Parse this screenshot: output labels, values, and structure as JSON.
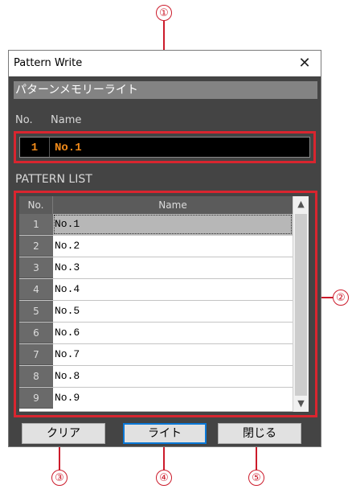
{
  "window": {
    "title": "Pattern Write",
    "heading": "パターンメモリーライト"
  },
  "current_pattern": {
    "no_label": "No.",
    "name_label": "Name",
    "no": "1",
    "name": "No.1"
  },
  "pattern_list": {
    "label": "PATTERN LIST",
    "columns": [
      "No.",
      "Name"
    ],
    "rows": [
      {
        "no": "1",
        "name": "No.1",
        "selected": true
      },
      {
        "no": "2",
        "name": "No.2"
      },
      {
        "no": "3",
        "name": "No.3"
      },
      {
        "no": "4",
        "name": "No.4"
      },
      {
        "no": "5",
        "name": "No.5"
      },
      {
        "no": "6",
        "name": "No.6"
      },
      {
        "no": "7",
        "name": "No.7"
      },
      {
        "no": "8",
        "name": "No.8"
      },
      {
        "no": "9",
        "name": "No.9"
      }
    ]
  },
  "buttons": {
    "clear": "クリア",
    "write": "ライト",
    "close": "閉じる"
  },
  "callouts": {
    "c1": "①",
    "c2": "②",
    "c3": "③",
    "c4": "④",
    "c5": "⑤"
  },
  "icons": {
    "close": "close-icon",
    "scroll_up": "chevron-up-icon",
    "scroll_down": "chevron-down-icon"
  },
  "colors": {
    "callout_red": "#d9252f",
    "selected_text": "#f08a1a",
    "primary_border": "#0a78d7"
  }
}
